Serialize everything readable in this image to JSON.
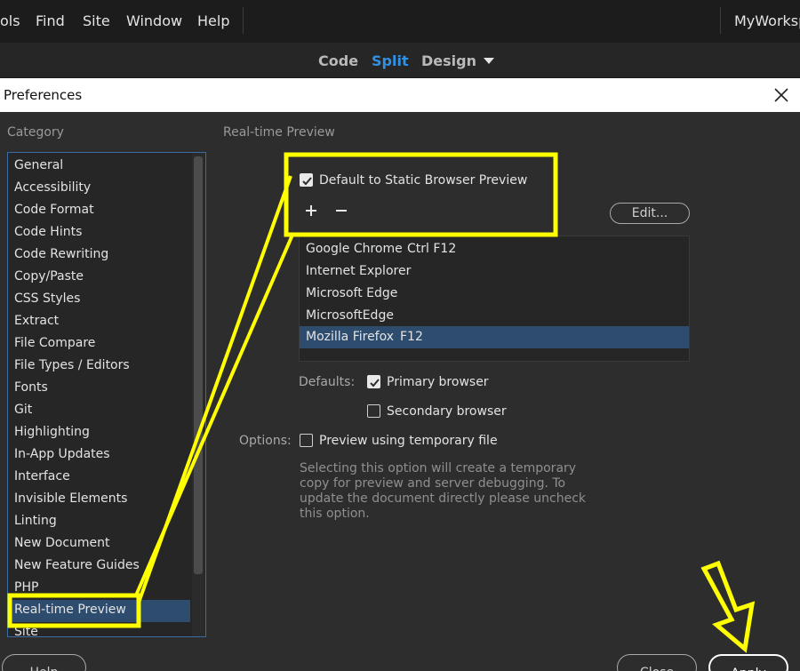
{
  "menubar": {
    "items": [
      "ols",
      "Find",
      "Site",
      "Window",
      "Help"
    ],
    "workspace": "MyWorksp"
  },
  "viewbar": {
    "code": "Code",
    "split": "Split",
    "design": "Design",
    "active": "Split"
  },
  "dialog": {
    "title": "Preferences"
  },
  "category": {
    "label": "Category",
    "items": [
      "General",
      "Accessibility",
      "Code Format",
      "Code Hints",
      "Code Rewriting",
      "Copy/Paste",
      "CSS Styles",
      "Extract",
      "File Compare",
      "File Types / Editors",
      "Fonts",
      "Git",
      "Highlighting",
      "In-App Updates",
      "Interface",
      "Invisible Elements",
      "Linting",
      "New Document",
      "New Feature Guides",
      "PHP",
      "Real-time Preview",
      "Site"
    ],
    "selected": "Real-time Preview"
  },
  "panel": {
    "title": "Real-time Preview",
    "static_preview_label": "Default to Static Browser Preview",
    "static_preview_checked": true,
    "add_symbol": "+",
    "remove_symbol": "−",
    "edit_label": "Edit...",
    "browsers": [
      {
        "name": "Google Chrome",
        "shortcut": "Ctrl F12"
      },
      {
        "name": "Internet Explorer",
        "shortcut": ""
      },
      {
        "name": "Microsoft Edge",
        "shortcut": ""
      },
      {
        "name": "MicrosoftEdge",
        "shortcut": ""
      },
      {
        "name": "Mozilla Firefox",
        "shortcut": "F12"
      }
    ],
    "selected_browser": "Mozilla Firefox",
    "defaults_label": "Defaults:",
    "primary_label": "Primary browser",
    "primary_checked": true,
    "secondary_label": "Secondary browser",
    "secondary_checked": false,
    "options_label": "Options:",
    "temp_file_label": "Preview using temporary file",
    "temp_file_checked": false,
    "description": "Selecting this option will create a temporary copy for preview and server debugging. To update the document directly please uncheck this option."
  },
  "buttons": {
    "help": "Help",
    "close": "Close",
    "apply": "Apply"
  },
  "colors": {
    "accent": "#2f91e8",
    "selection": "#2e4d6e",
    "annotation": "#ffff00",
    "background": "#2d2d2d"
  },
  "icons": [
    "close-icon",
    "checkmark-icon",
    "plus-icon",
    "minus-icon",
    "dropdown-caret-icon",
    "down-arrow-annotation"
  ]
}
